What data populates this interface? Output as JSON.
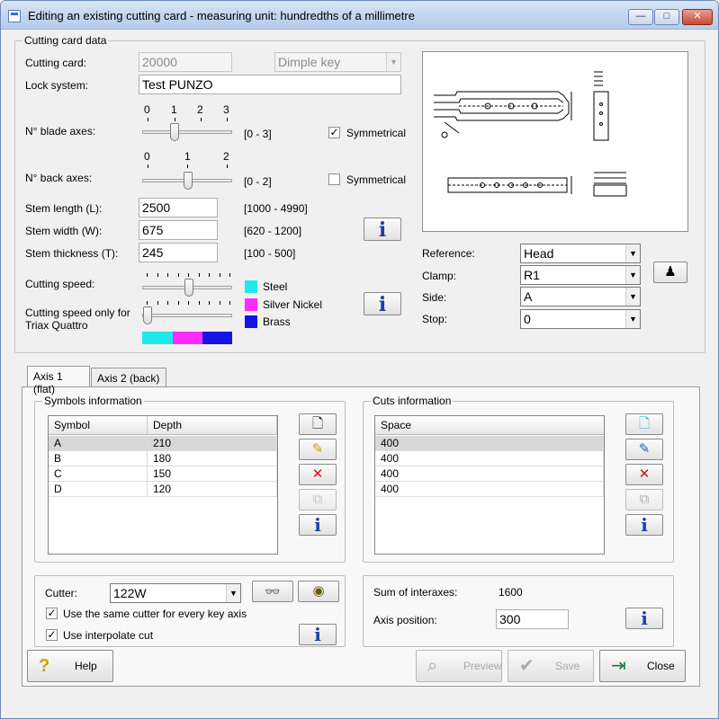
{
  "window": {
    "title": "Editing an existing cutting card - measuring unit: hundredths of a millimetre",
    "min_glyph": "—",
    "max_glyph": "□",
    "close_glyph": "✕"
  },
  "card": {
    "legend": "Cutting card data",
    "cutting_card_label": "Cutting card:",
    "cutting_card_value": "20000",
    "key_type_value": "Dimple key",
    "lock_system_label": "Lock system:",
    "lock_system_value": "Test PUNZO",
    "blade_axes_label": "N° blade axes:",
    "blade_ticks": [
      "0",
      "1",
      "2",
      "3"
    ],
    "blade_range": "[0 - 3]",
    "blade_symmetrical": "Symmetrical",
    "back_axes_label": "N° back axes:",
    "back_ticks": [
      "0",
      "1",
      "2"
    ],
    "back_range": "[0 - 2]",
    "back_symmetrical": "Symmetrical",
    "stem_length_label": "Stem length (L):",
    "stem_length_value": "2500",
    "stem_length_range": "[1000 - 4990]",
    "stem_width_label": "Stem width (W):",
    "stem_width_value": "675",
    "stem_width_range": "[620 - 1200]",
    "stem_thickness_label": "Stem thickness (T):",
    "stem_thickness_value": "245",
    "stem_thickness_range": "[100 - 500]",
    "cutting_speed_label": "Cutting speed:",
    "cutting_speed_triax_label_1": "Cutting speed only for",
    "cutting_speed_triax_label_2": "Triax Quattro",
    "materials": [
      {
        "name": "Steel",
        "color": "#21e8e8"
      },
      {
        "name": "Silver Nickel",
        "color": "#ff2bff"
      },
      {
        "name": "Brass",
        "color": "#1414e6"
      }
    ],
    "reference_label": "Reference:",
    "reference_value": "Head",
    "clamp_label": "Clamp:",
    "clamp_value": "R1",
    "side_label": "Side:",
    "side_value": "A",
    "stop_label": "Stop:",
    "stop_value": "0"
  },
  "tabs": [
    {
      "label": "Axis 1 (flat)"
    },
    {
      "label": "Axis 2  (back)"
    }
  ],
  "symbols": {
    "legend": "Symbols information",
    "headers": [
      "Symbol",
      "Depth"
    ],
    "rows": [
      {
        "symbol": "A",
        "depth": "210"
      },
      {
        "symbol": "B",
        "depth": "180"
      },
      {
        "symbol": "C",
        "depth": "150"
      },
      {
        "symbol": "D",
        "depth": "120"
      }
    ]
  },
  "cuts": {
    "legend": "Cuts information",
    "headers": [
      "Space"
    ],
    "rows": [
      {
        "space": "400"
      },
      {
        "space": "400"
      },
      {
        "space": "400"
      },
      {
        "space": "400"
      }
    ]
  },
  "cutter": {
    "label": "Cutter:",
    "value": "122W",
    "same_cutter_label": "Use the same cutter for every key axis",
    "interpolate_label": "Use interpolate cut"
  },
  "axis_info": {
    "sum_label": "Sum of interaxes:",
    "sum_value": "1600",
    "position_label": "Axis position:",
    "position_value": "300"
  },
  "buttons": {
    "help": "Help",
    "preview": "Preview",
    "save": "Save",
    "close": "Close",
    "info_glyph": "i"
  }
}
